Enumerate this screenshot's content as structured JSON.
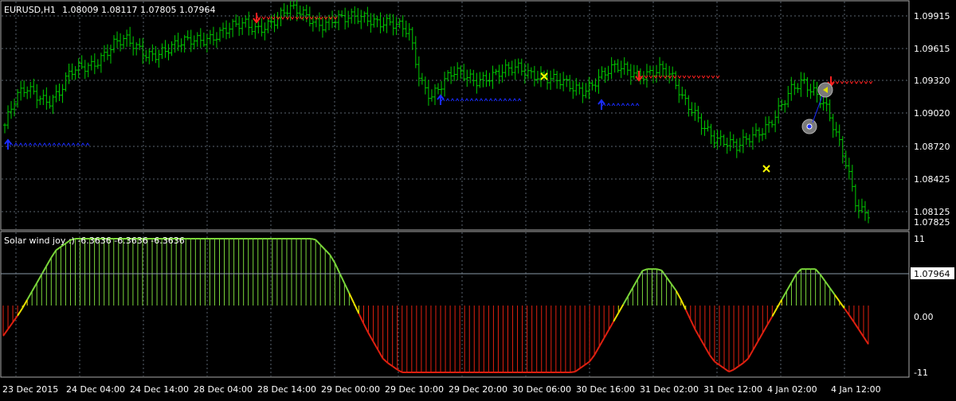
{
  "window": {
    "symbol_header": "EURUSD,H1",
    "ohlc": "1.08009 1.08117 1.07805 1.07964"
  },
  "indicator": {
    "label": "Solar wind joy :) -6.3636 -6.3636 -6.3636"
  },
  "price_axis": {
    "ticks": [
      "1.09915",
      "1.09615",
      "1.09320",
      "1.09020",
      "1.08720",
      "1.08425",
      "1.08125",
      "1.07825"
    ],
    "current_price_label": "1.07964"
  },
  "indicator_axis": {
    "ticks": [
      "11",
      "0.00",
      "-11"
    ]
  },
  "time_axis": {
    "labels": [
      "23 Dec 2015",
      "24 Dec 04:00",
      "24 Dec 14:00",
      "28 Dec 04:00",
      "28 Dec 14:00",
      "29 Dec 00:00",
      "29 Dec 10:00",
      "29 Dec 20:00",
      "30 Dec 06:00",
      "30 Dec 16:00",
      "31 Dec 02:00",
      "31 Dec 12:00",
      "4 Jan 02:00",
      "4 Jan 12:00"
    ]
  },
  "colors": {
    "background": "#000000",
    "grid": "#5a6470",
    "bars": "#00cc00",
    "osc_positive": "#7ad63a",
    "osc_negative": "#e02010",
    "osc_transition": "#e8e000",
    "sell_arrow": "#ff2020",
    "buy_arrow": "#1a2cff",
    "exit_cross": "#ffff00",
    "text": "#ffffff"
  },
  "chart_data": [
    {
      "type": "ohlc",
      "symbol": "EURUSD",
      "timeframe": "H1",
      "ylim": [
        1.0778,
        1.1001
      ],
      "grid": true,
      "closes_approx": [
        1.088,
        1.0905,
        1.0915,
        1.091,
        1.0905,
        1.0912,
        1.093,
        1.0935,
        1.094,
        1.095,
        1.096,
        1.0962,
        1.0955,
        1.095,
        1.0952,
        1.0955,
        1.0958,
        1.0962,
        1.0965,
        1.0968,
        1.0972,
        1.0975,
        1.0978,
        1.0975,
        1.098,
        1.0985,
        1.0992,
        1.099,
        1.0985,
        1.098,
        1.0983,
        1.0982,
        1.0985,
        1.0987,
        1.0983,
        1.098,
        1.0975,
        1.097,
        1.0925,
        1.091,
        1.092,
        1.093,
        1.0928,
        1.0925,
        1.0928,
        1.093,
        1.0932,
        1.0935,
        1.0932,
        1.093,
        1.0925,
        1.092,
        1.0915,
        1.0915,
        1.0925,
        1.0932,
        1.0935,
        1.0932,
        1.093,
        1.0933,
        1.0935,
        1.0925,
        1.0905,
        1.0895,
        1.088,
        1.0865,
        1.086,
        1.0858,
        1.087,
        1.0875,
        1.088,
        1.0895,
        1.0915,
        1.0925,
        1.0915,
        1.09,
        1.087,
        1.084,
        1.08,
        1.0796
      ]
    },
    {
      "type": "histogram",
      "name": "Solar wind joy",
      "ylim": [
        -11,
        11
      ],
      "values_shape": [
        -5,
        -1,
        4,
        9,
        11,
        11,
        11,
        11,
        11,
        11,
        11,
        11,
        11,
        11,
        11,
        11,
        11,
        11,
        11,
        8,
        2,
        -4,
        -9,
        -11,
        -11,
        -11,
        -11,
        -11,
        -11,
        -11,
        -11,
        -11,
        -11,
        -11,
        -9,
        -4,
        1,
        6,
        6,
        2,
        -4,
        -9,
        -11,
        -9,
        -4,
        1,
        6,
        6,
        2,
        -2,
        -6.36
      ],
      "last_value": -6.3636
    }
  ]
}
